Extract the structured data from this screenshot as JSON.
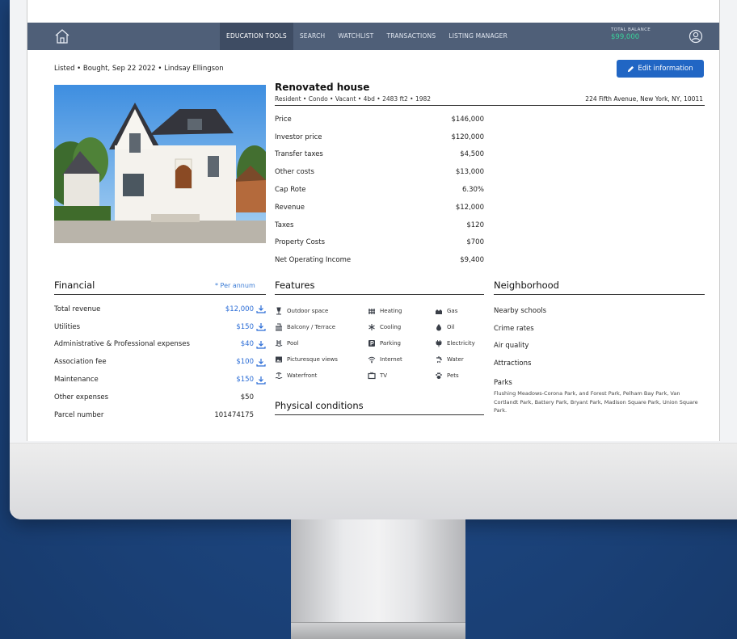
{
  "nav": {
    "items": [
      {
        "label": "EDUCATION TOOLS",
        "active": true
      },
      {
        "label": "SEARCH",
        "active": false
      },
      {
        "label": "WATCHLIST",
        "active": false
      },
      {
        "label": "TRANSACTIONS",
        "active": false
      },
      {
        "label": "LISTING MANAGER",
        "active": false
      }
    ],
    "balance_label": "TOTAL BALANCE",
    "balance_value": "$99,000"
  },
  "listing": {
    "status_line": "Listed • Bought, Sep 22 2022 • Lindsay Ellingson",
    "edit_label": "Edit information",
    "title": "Renovated house",
    "subtitle": "Resident • Condo • Vacant • 4bd • 2483 ft2 • 1982",
    "address": "224 Fifth Avenue, New York, NY, 10011"
  },
  "prices": [
    {
      "label": "Price",
      "value": "$146,000"
    },
    {
      "label": "Investor price",
      "value": "$120,000"
    },
    {
      "label": "Transfer taxes",
      "value": "$4,500"
    },
    {
      "label": "Other costs",
      "value": "$13,000"
    },
    {
      "label": "Cap Rote",
      "value": "6.30%"
    },
    {
      "label": "Revenue",
      "value": "$12,000"
    },
    {
      "label": "Taxes",
      "value": "$120"
    },
    {
      "label": "Property Costs",
      "value": "$700"
    },
    {
      "label": "Net Operating Income",
      "value": "$9,400"
    }
  ],
  "financial": {
    "title": "Financial",
    "note": "* Per annum",
    "rows": [
      {
        "label": "Total revenue",
        "value": "$12,000",
        "download": true
      },
      {
        "label": "Utilities",
        "value": "$150",
        "download": true
      },
      {
        "label": "Administrative & Professional expenses",
        "value": "$40",
        "download": true
      },
      {
        "label": "Association fee",
        "value": "$100",
        "download": true
      },
      {
        "label": "Maintenance",
        "value": "$150",
        "download": true
      },
      {
        "label": "Other expenses",
        "value": "$50",
        "download": false
      },
      {
        "label": "Parcel number",
        "value": "101474175",
        "download": false
      }
    ]
  },
  "features": {
    "title": "Features",
    "columns": [
      [
        {
          "label": "Outdoor space",
          "icon": "outdoor-icon"
        },
        {
          "label": "Balcony / Terrace",
          "icon": "balcony-icon"
        },
        {
          "label": "Pool",
          "icon": "pool-icon"
        },
        {
          "label": "Picturesque views",
          "icon": "views-icon"
        },
        {
          "label": "Waterfront",
          "icon": "waterfront-icon"
        }
      ],
      [
        {
          "label": "Heating",
          "icon": "heating-icon"
        },
        {
          "label": "Cooling",
          "icon": "snowflake-icon"
        },
        {
          "label": "Parking",
          "icon": "parking-icon"
        },
        {
          "label": "Internet",
          "icon": "wifi-icon"
        },
        {
          "label": "TV",
          "icon": "tv-icon"
        }
      ],
      [
        {
          "label": "Gas",
          "icon": "gas-icon"
        },
        {
          "label": "Oil",
          "icon": "oil-drop-icon"
        },
        {
          "label": "Electricity",
          "icon": "plug-icon"
        },
        {
          "label": "Water",
          "icon": "faucet-icon"
        },
        {
          "label": "Pets",
          "icon": "paw-icon"
        }
      ]
    ]
  },
  "physical": {
    "title": "Physical conditions"
  },
  "neighborhood": {
    "title": "Neighborhood",
    "items": [
      "Nearby schools",
      "Crime rates",
      "Air quality",
      "Attractions"
    ],
    "parks_title": "Parks",
    "parks_text": "Flushing Meadows-Corona Park, and Forest Park, Pelham Bay Park, Van Cortlandt Park, Battery Park, Bryant Park, Madison Square Park, Union Square Park."
  },
  "colors": {
    "nav_bg": "#4f5f78",
    "accent_blue": "#2166c4",
    "balance_green": "#3ad29a",
    "background": "#1d4680"
  }
}
